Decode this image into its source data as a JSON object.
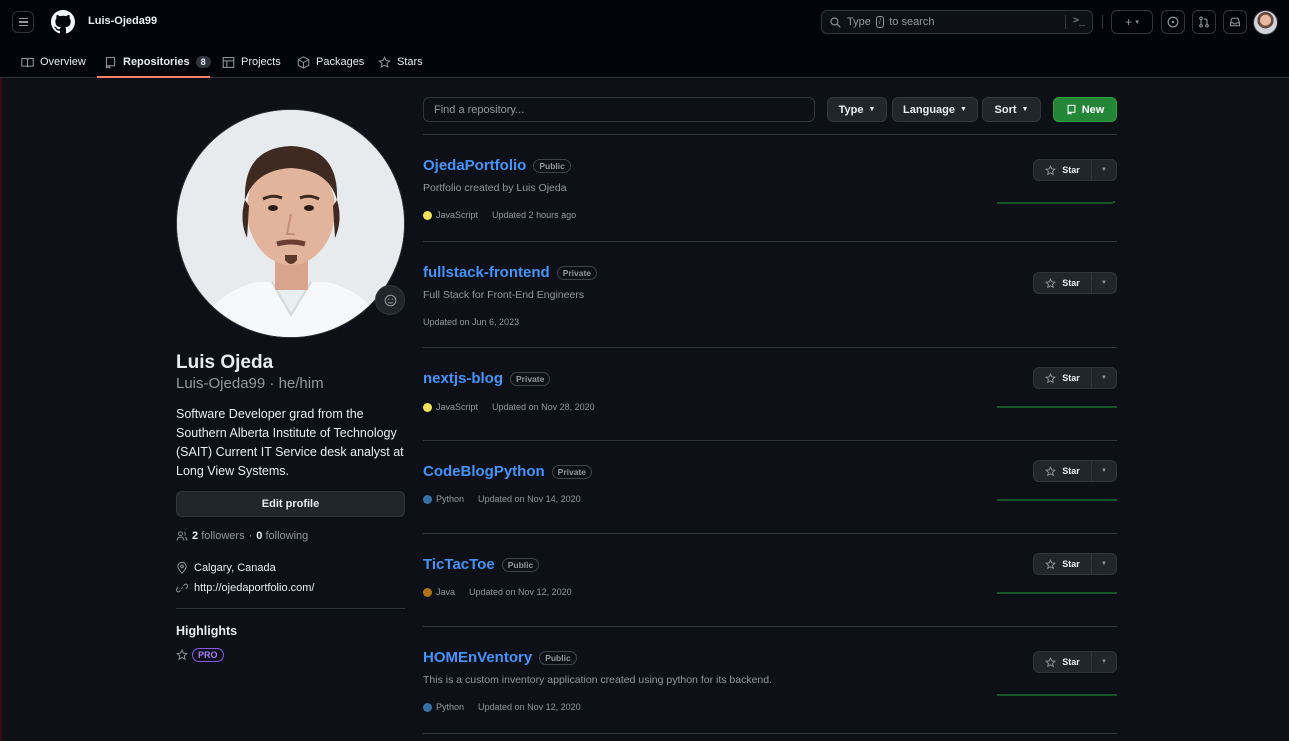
{
  "header": {
    "username": "Luis-Ojeda99",
    "search": {
      "prefix": "Type",
      "key": "/",
      "suffix": "to search"
    },
    "icons": [
      "hamburger-icon",
      "github-logo-icon",
      "search-icon",
      "command-palette-icon",
      "plus-icon",
      "issues-icon",
      "pull-requests-icon",
      "inbox-icon",
      "avatar"
    ]
  },
  "tabs": [
    {
      "label": "Overview",
      "icon": "book-icon"
    },
    {
      "label": "Repositories",
      "icon": "repo-icon",
      "count": "8",
      "active": true
    },
    {
      "label": "Projects",
      "icon": "table-icon"
    },
    {
      "label": "Packages",
      "icon": "package-icon"
    },
    {
      "label": "Stars",
      "icon": "star-icon"
    }
  ],
  "profile": {
    "name": "Luis Ojeda",
    "login": "Luis-Ojeda99",
    "pronouns": "he/him",
    "bio": "Software Developer grad from the Southern Alberta Institute of Technology (SAIT) Current IT Service desk analyst at Long View Systems.",
    "edit_label": "Edit profile",
    "followers": "2",
    "followers_label": "followers",
    "following": "0",
    "following_label": "following",
    "location": "Calgary, Canada",
    "website": "http://ojedaportfolio.com/",
    "highlights_title": "Highlights",
    "pro_badge": "PRO"
  },
  "filters": {
    "search_placeholder": "Find a repository...",
    "type_label": "Type",
    "language_label": "Language",
    "sort_label": "Sort",
    "new_label": "New"
  },
  "colors": {
    "accent_link": "#4493f8",
    "new_button": "#238636",
    "tab_underline": "#f78166",
    "javascript": "#f1e05a",
    "python": "#3572A5",
    "java": "#b07219"
  },
  "repos": [
    {
      "name": "OjedaPortfolio",
      "visibility": "Public",
      "description": "Portfolio created by Luis Ojeda",
      "language": "JavaScript",
      "lang_color": "#f1e05a",
      "updated": "Updated 2 hours ago",
      "star_label": "Star"
    },
    {
      "name": "fullstack-frontend",
      "visibility": "Private",
      "description": "Full Stack for Front-End Engineers",
      "language": "",
      "lang_color": "",
      "updated": "Updated on Jun 6, 2023",
      "star_label": "Star"
    },
    {
      "name": "nextjs-blog",
      "visibility": "Private",
      "description": "",
      "language": "JavaScript",
      "lang_color": "#f1e05a",
      "updated": "Updated on Nov 28, 2020",
      "star_label": "Star"
    },
    {
      "name": "CodeBlogPython",
      "visibility": "Private",
      "description": "",
      "language": "Python",
      "lang_color": "#3572A5",
      "updated": "Updated on Nov 14, 2020",
      "star_label": "Star"
    },
    {
      "name": "TicTacToe",
      "visibility": "Public",
      "description": "",
      "language": "Java",
      "lang_color": "#b07219",
      "updated": "Updated on Nov 12, 2020",
      "star_label": "Star"
    },
    {
      "name": "HOMEnVentory",
      "visibility": "Public",
      "description": "This is a custom inventory application created using python for its backend.",
      "language": "Python",
      "lang_color": "#3572A5",
      "updated": "Updated on Nov 12, 2020",
      "star_label": "Star"
    }
  ]
}
